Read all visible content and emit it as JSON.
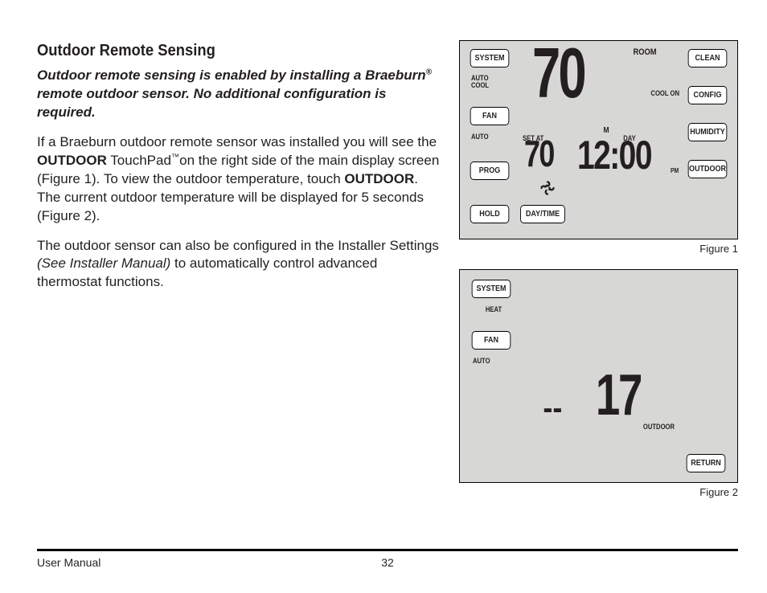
{
  "heading": "Outdoor Remote Sensing",
  "intro_a": "Outdoor remote sensing is enabled by installing a Braeburn",
  "intro_reg": "®",
  "intro_b": " remote outdoor sensor. No additional configuration is required.",
  "p1_a": "If a Braeburn outdoor remote sensor was installed you will see the ",
  "p1_outdoor": "OUTDOOR",
  "p1_b": " TouchPad",
  "p1_tm": "™",
  "p1_c": "on the right side of the main display screen (Figure 1). To view the outdoor temperature, touch ",
  "p1_outdoor2": "OUTDOOR",
  "p1_d": ". The current outdoor temperature will be displayed for 5 seconds (Figure 2).",
  "p2_a": "The outdoor sensor can also be configured in the Installer Settings ",
  "p2_i": "(See Installer Manual)",
  "p2_b": " to automatically control advanced thermostat functions.",
  "fig1": {
    "caption": "Figure 1",
    "btn_system": "SYSTEM",
    "btn_fan": "FAN",
    "btn_prog": "PROG",
    "btn_hold": "HOLD",
    "btn_daytime": "DAY/TIME",
    "btn_clean": "CLEAN",
    "btn_config": "CONFIG",
    "btn_humidity": "HUMIDITY",
    "btn_outdoor": "OUTDOOR",
    "status_mode_l1": "AUTO",
    "status_mode_l2": "COOL",
    "status_fan": "AUTO",
    "status_room": "ROOM",
    "status_coolon": "COOL ON",
    "status_setat": "SET AT",
    "status_dayletter": "M",
    "status_day": "DAY",
    "status_pm": "PM",
    "temp_room": "70",
    "temp_set": "70",
    "clock": "12:00"
  },
  "fig2": {
    "caption": "Figure 2",
    "btn_system": "SYSTEM",
    "btn_fan": "FAN",
    "btn_return": "RETURN",
    "status_mode": "HEAT",
    "status_fan": "AUTO",
    "status_outdoor": "OUTDOOR",
    "dash": "--",
    "temp_out": "17"
  },
  "footer_left": "User Manual",
  "footer_page": "32"
}
